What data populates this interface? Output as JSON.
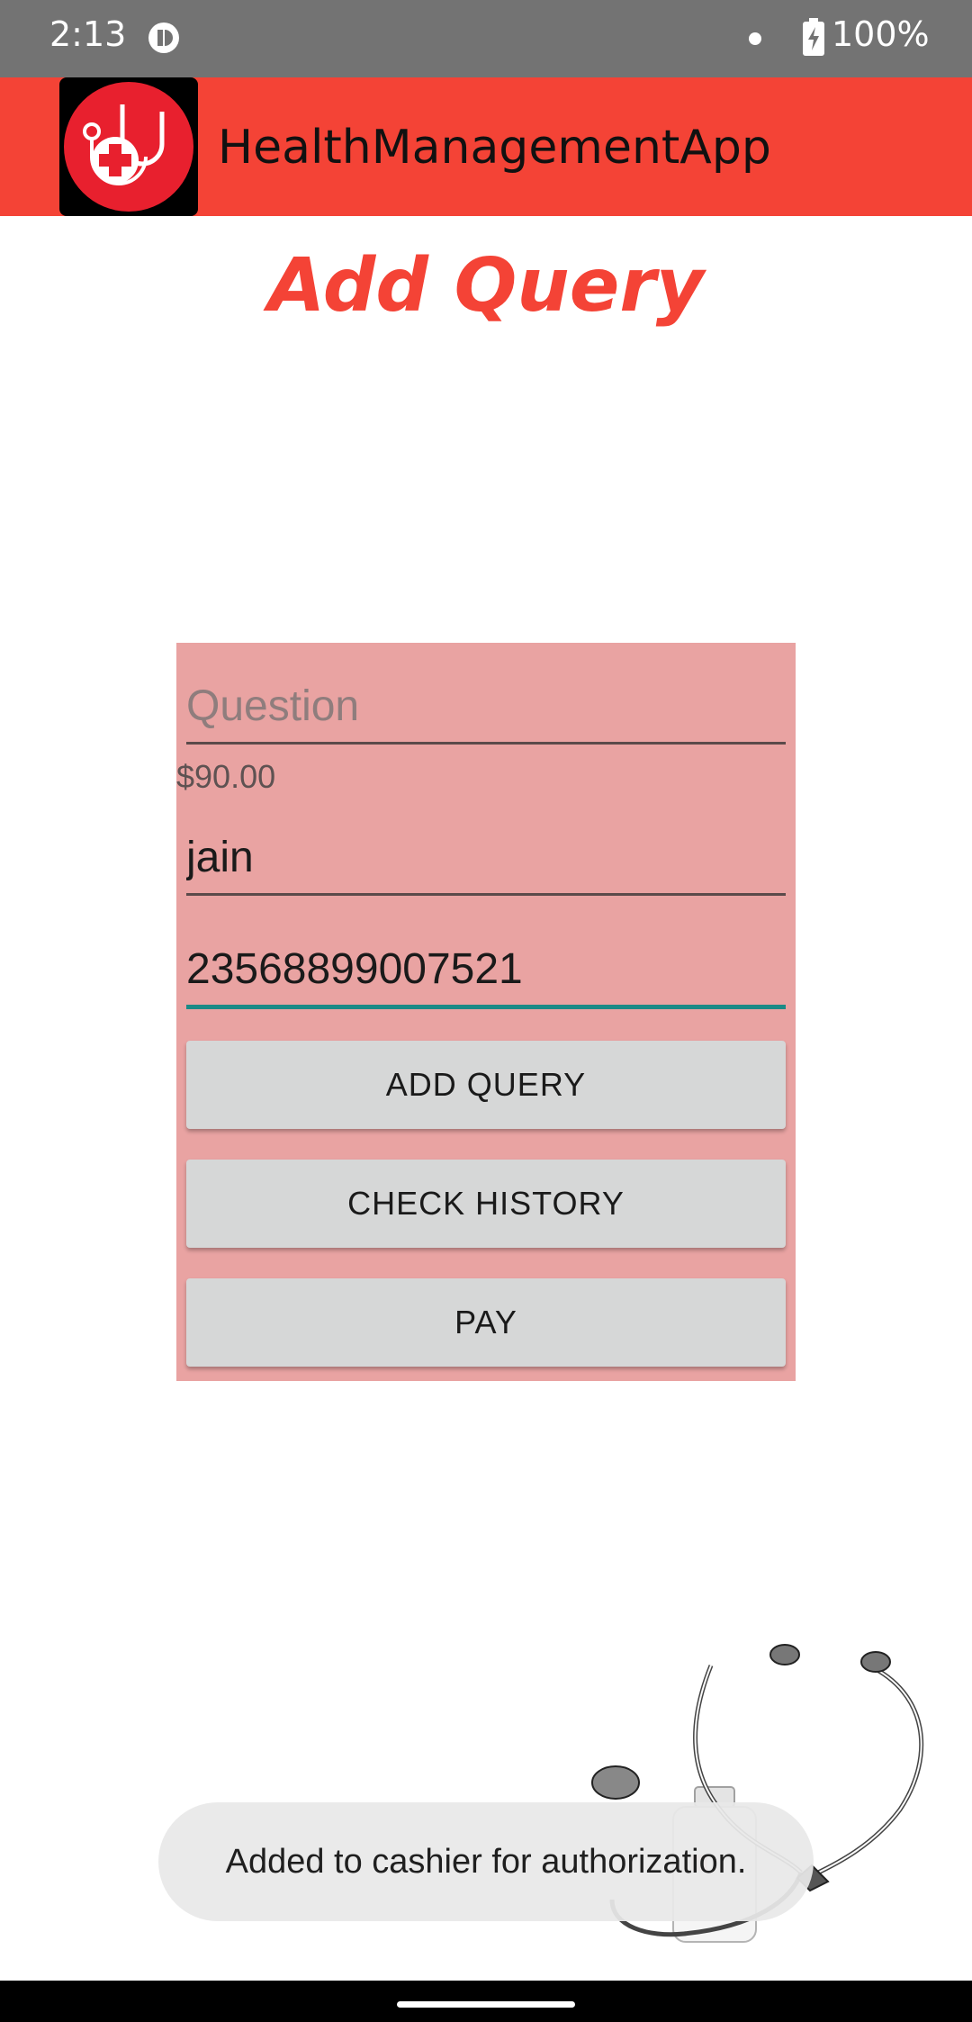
{
  "status_bar": {
    "time": "2:13",
    "battery": "100%"
  },
  "app_bar": {
    "title": "HealthManagementApp",
    "logo_icon": "medical-stethoscope-cross-icon",
    "color": "#f44336"
  },
  "page": {
    "title": "Add Query"
  },
  "form": {
    "question_placeholder": "Question",
    "question_value": "",
    "price": "$90.00",
    "name_value": "jain",
    "card_value": "23568899007521",
    "background": "#e9a3a2"
  },
  "buttons": {
    "add_query": "ADD QUERY",
    "check_history": "CHECK HISTORY",
    "pay": "PAY"
  },
  "toast": {
    "message": "Added to cashier for authorization."
  }
}
